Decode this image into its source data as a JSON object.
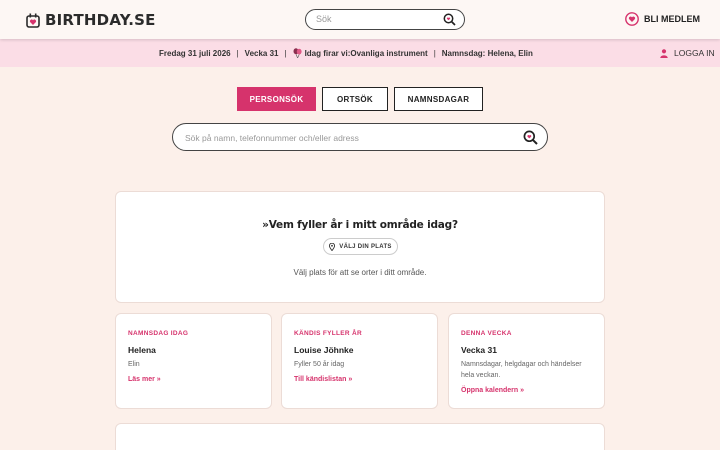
{
  "header": {
    "logo_text": "BIRTHDAY.SE",
    "search_placeholder": "Sök",
    "member_label": "BLI MEDLEM"
  },
  "infobar": {
    "date": "Fredag 31 juli 2026",
    "week": "Vecka 31",
    "celebrates": "Idag firar vi:Ovanliga instrument",
    "nameday": "Namnsdag: Helena, Elin",
    "login_label": "LOGGA IN"
  },
  "tabs": [
    "PERSONSÖK",
    "ORTSÖK",
    "NAMNSDAGAR"
  ],
  "main_search": {
    "placeholder": "Sök på namn, telefonnummer och/eller adress"
  },
  "local_card": {
    "question": "»Vem fyller år i mitt område idag?",
    "place_button": "VÄLJ DIN PLATS",
    "subtext": "Välj plats för att se orter i ditt område."
  },
  "cards": [
    {
      "label": "NAMNSDAG IDAG",
      "title": "Helena",
      "text": "Elin",
      "link": "Läs mer »"
    },
    {
      "label": "KÄNDIS FYLLER ÅR",
      "title": "Louise Jöhnke",
      "text": "Fyller 50 år idag",
      "link": "Till kändislistan »"
    },
    {
      "label": "DENNA VECKA",
      "title": "Vecka 31",
      "text": "Namnsdagar, helgdagar och händelser hela veckan.",
      "link": "Öppna kalendern »"
    }
  ],
  "colors": {
    "accent": "#d6336c",
    "background": "#fcf0ea",
    "infobar": "#fbdde6"
  },
  "icons": [
    "calendar-heart-icon",
    "search-icon",
    "heart-icon",
    "balloon-icon",
    "user-icon",
    "location-pin-icon"
  ]
}
